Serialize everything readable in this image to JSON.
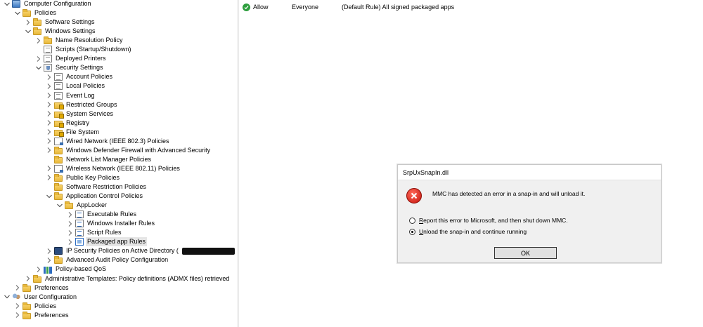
{
  "tree": [
    {
      "label": "Computer Configuration",
      "icon": "computer-icon",
      "state": "expanded",
      "depth": 0
    },
    {
      "label": "Policies",
      "icon": "folder-icon",
      "state": "expanded",
      "depth": 1
    },
    {
      "label": "Software Settings",
      "icon": "folder-icon",
      "state": "collapsed",
      "depth": 2
    },
    {
      "label": "Windows Settings",
      "icon": "folder-icon",
      "state": "expanded",
      "depth": 2
    },
    {
      "label": "Name Resolution Policy",
      "icon": "folder-icon",
      "state": "collapsed",
      "depth": 3
    },
    {
      "label": "Scripts (Startup/Shutdown)",
      "icon": "script-page-icon",
      "state": "leaf",
      "depth": 3
    },
    {
      "label": "Deployed Printers",
      "icon": "printer-icon",
      "state": "collapsed",
      "depth": 3
    },
    {
      "label": "Security Settings",
      "icon": "security-settings-icon",
      "state": "expanded",
      "depth": 3
    },
    {
      "label": "Account Policies",
      "icon": "policy-page-icon",
      "state": "collapsed",
      "depth": 4
    },
    {
      "label": "Local Policies",
      "icon": "policy-page-icon",
      "state": "collapsed",
      "depth": 4
    },
    {
      "label": "Event Log",
      "icon": "policy-page-icon",
      "state": "collapsed",
      "depth": 4
    },
    {
      "label": "Restricted Groups",
      "icon": "locked-folder-icon",
      "state": "collapsed",
      "depth": 4
    },
    {
      "label": "System Services",
      "icon": "locked-folder-icon",
      "state": "collapsed",
      "depth": 4
    },
    {
      "label": "Registry",
      "icon": "locked-folder-icon",
      "state": "collapsed",
      "depth": 4
    },
    {
      "label": "File System",
      "icon": "locked-folder-icon",
      "state": "collapsed",
      "depth": 4
    },
    {
      "label": "Wired Network (IEEE 802.3) Policies",
      "icon": "network-page-icon",
      "state": "collapsed",
      "depth": 4
    },
    {
      "label": "Windows Defender Firewall with Advanced Security",
      "icon": "folder-icon",
      "state": "collapsed",
      "depth": 4
    },
    {
      "label": "Network List Manager Policies",
      "icon": "folder-icon",
      "state": "leaf",
      "depth": 4
    },
    {
      "label": "Wireless Network (IEEE 802.11) Policies",
      "icon": "network-page-icon",
      "state": "collapsed",
      "depth": 4
    },
    {
      "label": "Public Key Policies",
      "icon": "folder-icon",
      "state": "collapsed",
      "depth": 4
    },
    {
      "label": "Software Restriction Policies",
      "icon": "folder-icon",
      "state": "leaf",
      "depth": 4
    },
    {
      "label": "Application Control Policies",
      "icon": "folder-icon",
      "state": "expanded",
      "depth": 4
    },
    {
      "label": "AppLocker",
      "icon": "applocker-icon",
      "state": "expanded",
      "depth": 5
    },
    {
      "label": "Executable Rules",
      "icon": "rule-list-icon",
      "state": "collapsed",
      "depth": 6
    },
    {
      "label": "Windows Installer Rules",
      "icon": "rule-list-icon",
      "state": "collapsed",
      "depth": 6
    },
    {
      "label": "Script Rules",
      "icon": "rule-list-icon",
      "state": "collapsed",
      "depth": 6
    },
    {
      "label": "Packaged app Rules",
      "icon": "packaged-app-rules-icon",
      "state": "collapsed",
      "depth": 6,
      "selected": true
    },
    {
      "label": "IP Security Policies on Active Directory (",
      "icon": "ipsec-icon",
      "state": "collapsed",
      "depth": 4,
      "redacted_suffix": true
    },
    {
      "label": "Advanced Audit Policy Configuration",
      "icon": "folder-icon",
      "state": "collapsed",
      "depth": 4
    },
    {
      "label": "Policy-based QoS",
      "icon": "bar-chart-icon",
      "state": "collapsed",
      "depth": 3
    },
    {
      "label": "Administrative Templates: Policy definitions (ADMX files) retrieved",
      "icon": "folder-icon",
      "state": "collapsed",
      "depth": 2
    },
    {
      "label": "Preferences",
      "icon": "folder-icon",
      "state": "collapsed",
      "depth": 1
    },
    {
      "label": "User Configuration",
      "icon": "users-icon",
      "state": "expanded",
      "depth": 0
    },
    {
      "label": "Policies",
      "icon": "folder-icon",
      "state": "collapsed",
      "depth": 1
    },
    {
      "label": "Preferences",
      "icon": "folder-icon",
      "state": "collapsed",
      "depth": 1
    }
  ],
  "rules": [
    {
      "action": "Allow",
      "user": "Everyone",
      "name": "(Default Rule) All signed packaged apps",
      "status_icon": "allow-check-icon"
    }
  ],
  "dialog": {
    "title": "SrpUxSnapIn.dll",
    "message": "MMC has detected an error in a snap-in and will unload it.",
    "option1_hotkey": "R",
    "option1_rest": "eport this error to Microsoft, and then shut down MMC.",
    "option2_hotkey": "U",
    "option2_rest": "nload the snap-in and continue running",
    "selected_option": 2,
    "ok_label": "OK"
  },
  "colors": {
    "allow": "#2e9e3e",
    "error": "#c4120a",
    "selection": "#e5e5e5",
    "dialog_bg": "#f0f0f0"
  }
}
